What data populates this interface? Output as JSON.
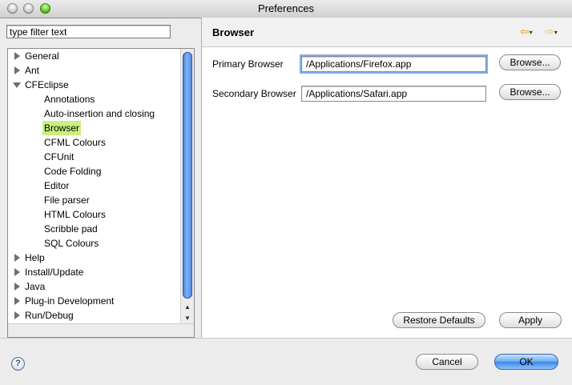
{
  "window": {
    "title": "Preferences"
  },
  "filter": {
    "placeholder": "type filter text",
    "value": "type filter text"
  },
  "tree": {
    "items": [
      {
        "label": "General",
        "expanded": false
      },
      {
        "label": "Ant",
        "expanded": false
      },
      {
        "label": "CFEclipse",
        "expanded": true
      },
      {
        "label": "Annotations",
        "child": true
      },
      {
        "label": "Auto-insertion and closing",
        "child": true
      },
      {
        "label": "Browser",
        "child": true,
        "selected": true
      },
      {
        "label": "CFML Colours",
        "child": true
      },
      {
        "label": "CFUnit",
        "child": true
      },
      {
        "label": "Code Folding",
        "child": true
      },
      {
        "label": "Editor",
        "child": true
      },
      {
        "label": "File parser",
        "child": true
      },
      {
        "label": "HTML Colours",
        "child": true
      },
      {
        "label": "Scribble pad",
        "child": true
      },
      {
        "label": "SQL Colours",
        "child": true
      },
      {
        "label": "Help",
        "expanded": false
      },
      {
        "label": "Install/Update",
        "expanded": false
      },
      {
        "label": "Java",
        "expanded": false
      },
      {
        "label": "Plug-in Development",
        "expanded": false
      },
      {
        "label": "Run/Debug",
        "expanded": false
      }
    ]
  },
  "page": {
    "title": "Browser",
    "primary": {
      "label": "Primary Browser",
      "value": "/Applications/Firefox.app",
      "button": "Browse..."
    },
    "secondary": {
      "label": "Secondary Browser",
      "value": "/Applications/Safari.app",
      "button": "Browse..."
    },
    "restore_label": "Restore Defaults",
    "apply_label": "Apply"
  },
  "footer": {
    "help_glyph": "?",
    "cancel_label": "Cancel",
    "ok_label": "OK"
  }
}
